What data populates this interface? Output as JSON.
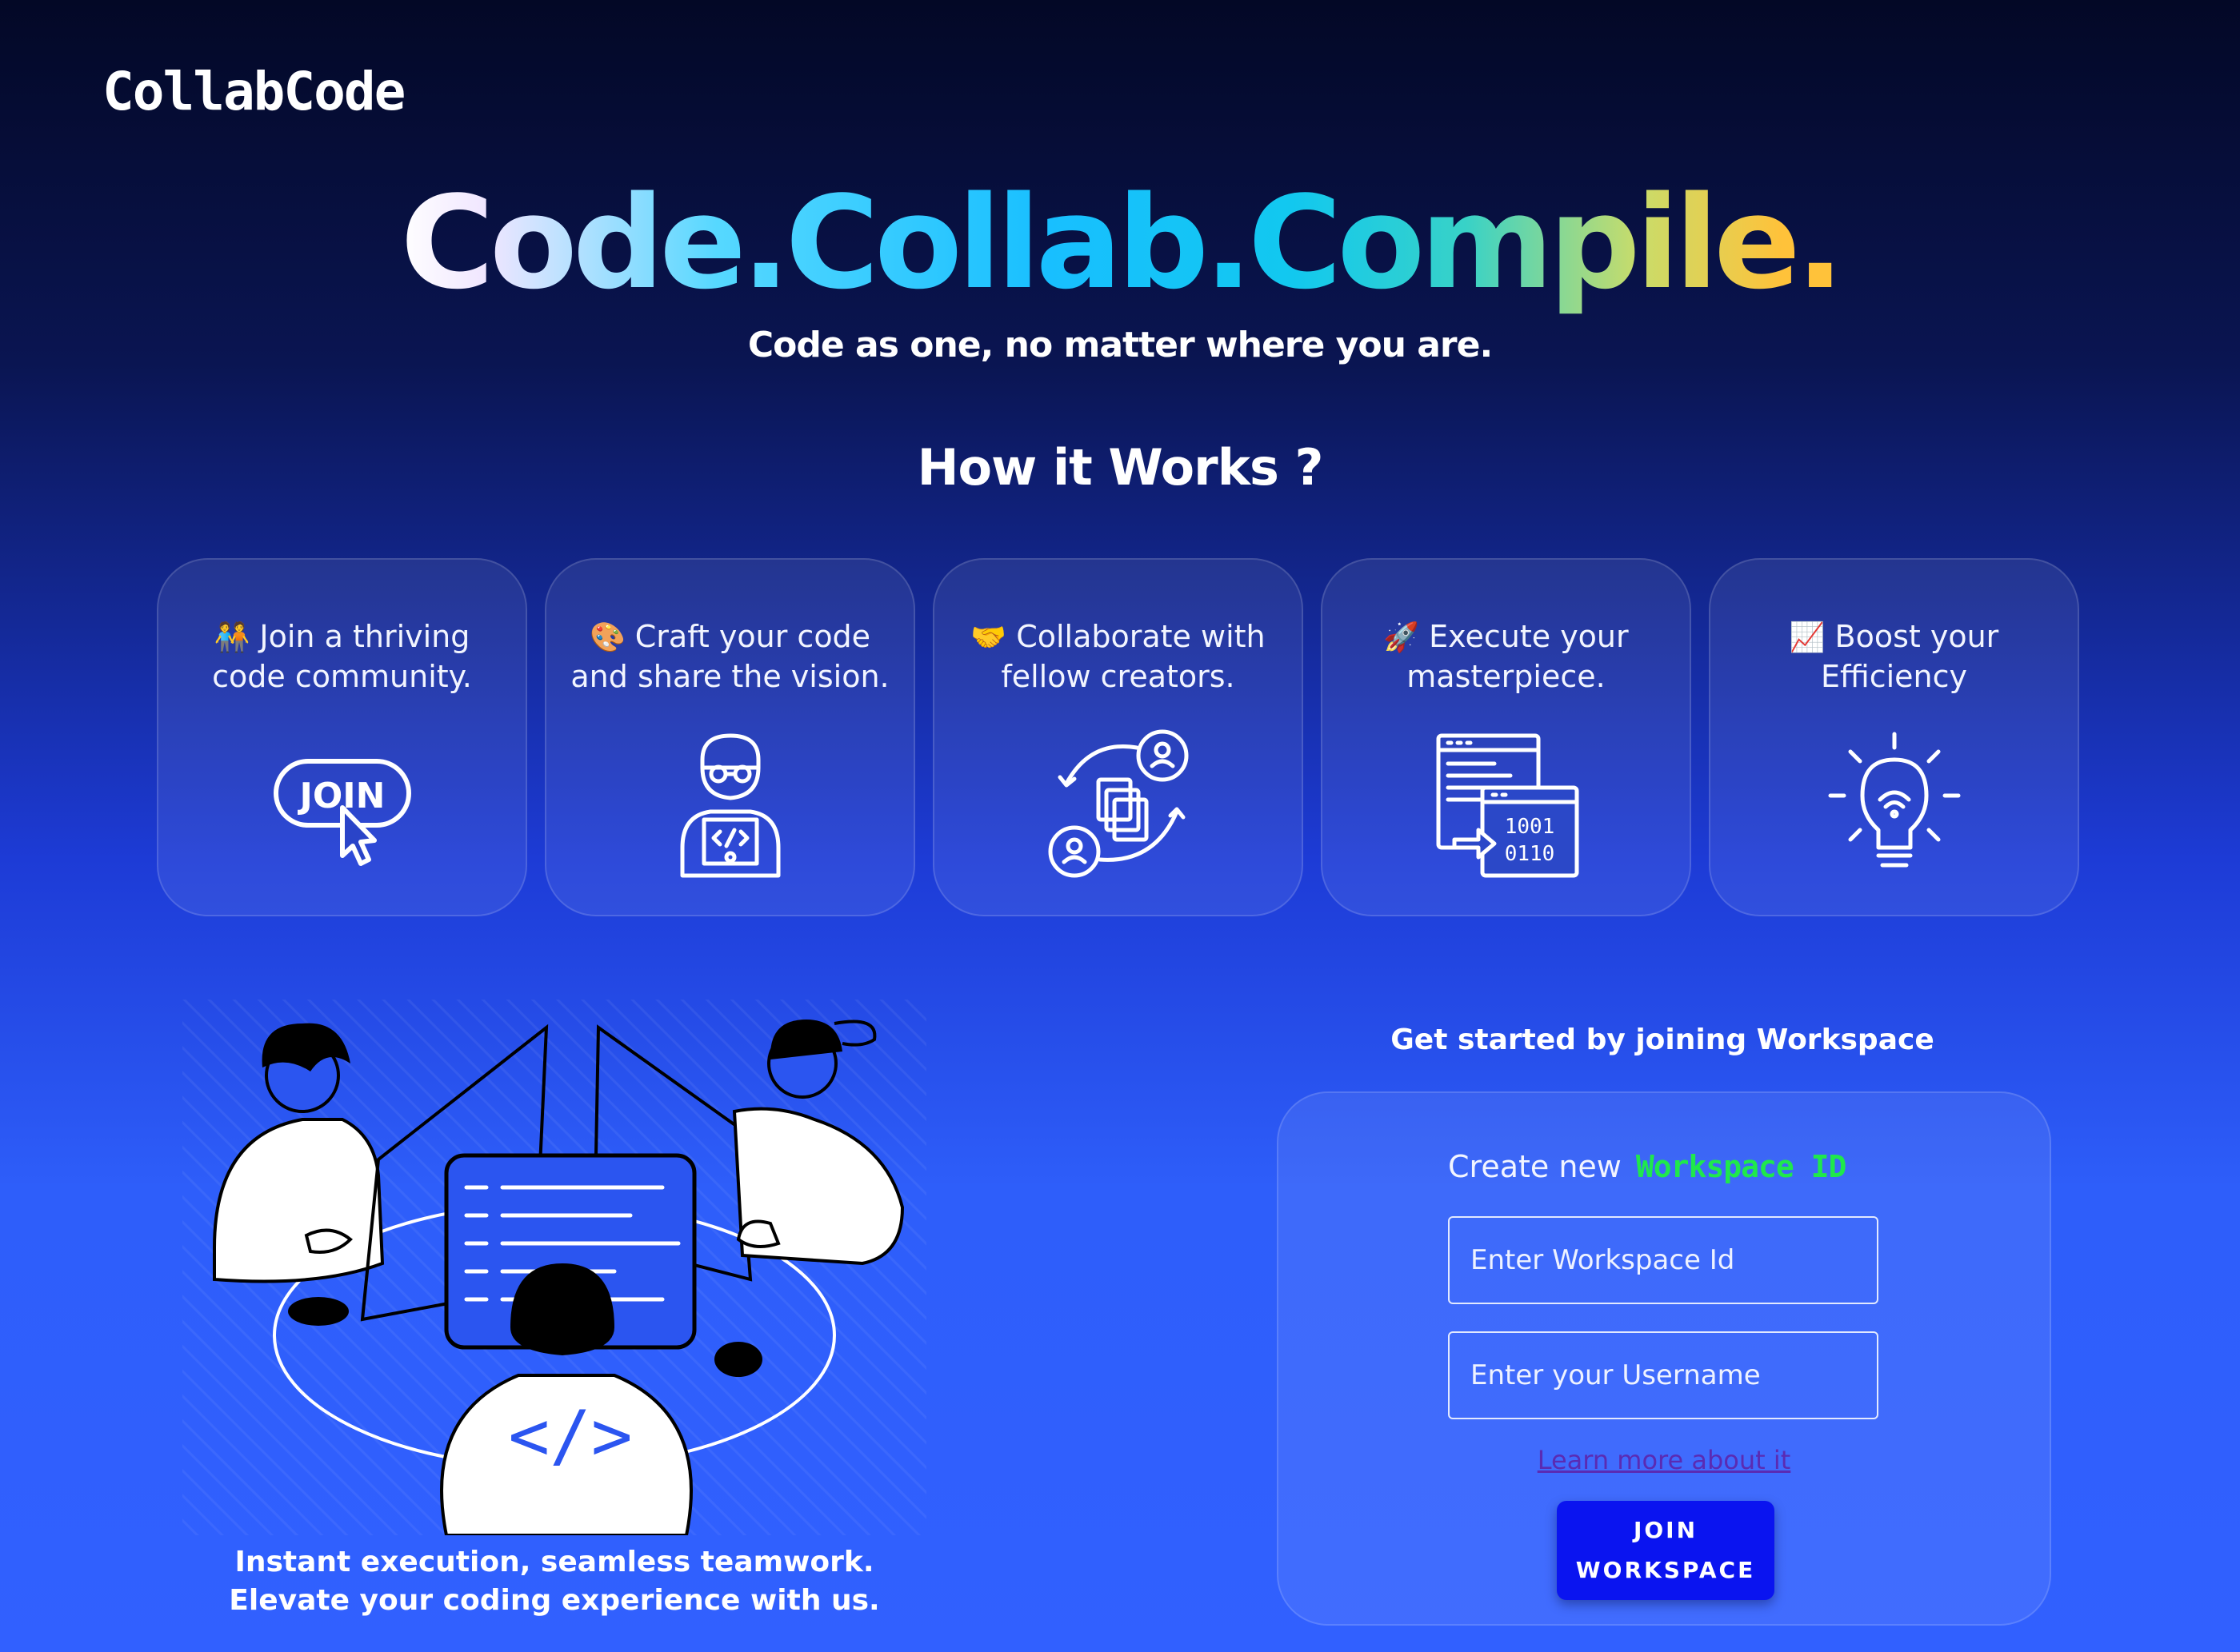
{
  "brand": {
    "name": "CollabCode"
  },
  "hero": {
    "title": "Code.Collab.Compile.",
    "subtitle": "Code as one, no matter where you are."
  },
  "how": {
    "title": "How it Works ?",
    "cards": [
      {
        "emoji": "🧑‍🤝‍🧑",
        "text": "Join a thriving\ncode community.",
        "icon": "join-icon"
      },
      {
        "emoji": "🎨",
        "text": "Craft your code\nand share the vision.",
        "icon": "developer-icon"
      },
      {
        "emoji": "🤝",
        "text": "Collaborate with\nfellow creators.",
        "icon": "collaboration-icon"
      },
      {
        "emoji": "🚀",
        "text": "Execute your\nmasterpiece.",
        "icon": "code-execute-icon"
      },
      {
        "emoji": "📈",
        "text": "Boost your\nEfficiency",
        "icon": "lightbulb-icon"
      }
    ]
  },
  "illustration": {
    "caption": "Instant execution, seamless teamwork.\nElevate your coding experience with us."
  },
  "workspace": {
    "heading": "Get started by joining Workspace",
    "create_label": "Create new",
    "create_link": "Workspace ID",
    "workspace_placeholder": "Enter Workspace Id",
    "username_placeholder": "Enter your Username",
    "learn_more": "Learn more about it",
    "join_label": "JOIN\nWORKSPACE",
    "accent_color": "#1fe84c",
    "button_color": "#0a14f0"
  }
}
